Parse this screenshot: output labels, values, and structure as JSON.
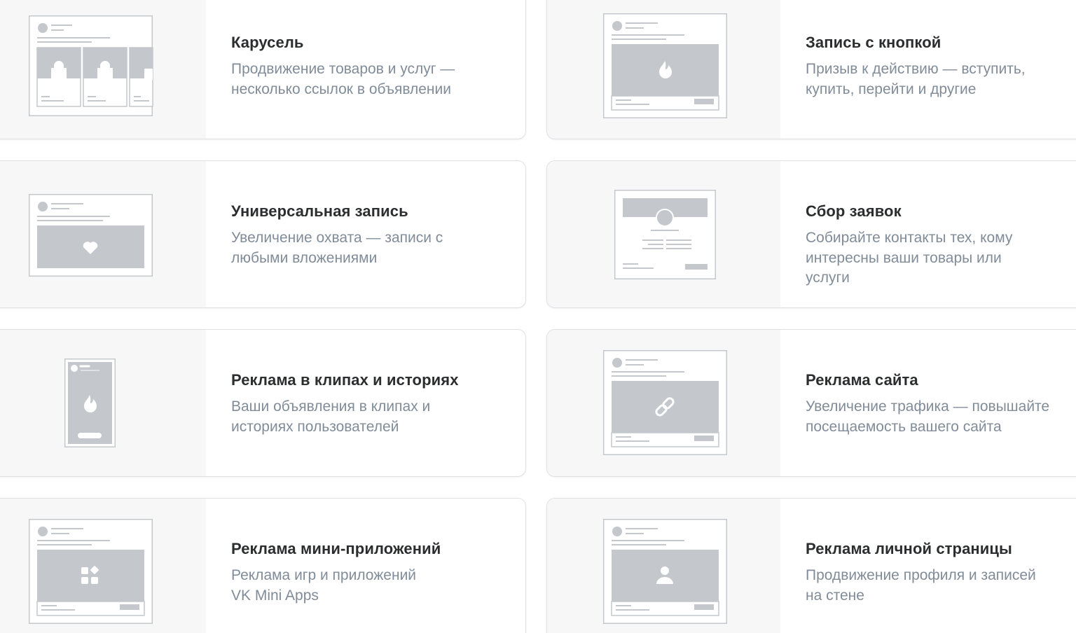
{
  "colors": {
    "card_border": "#dfe1e5",
    "thumb_bg": "#f7f7f8",
    "placeholder": "#c4c8cc",
    "title": "#2c2d2e",
    "description": "#818c99"
  },
  "cards": [
    {
      "id": "carousel",
      "icon": "carousel-preview",
      "title": "Карусель",
      "desc": "Продвижение товаров и услуг —\nнесколько ссылок в объявлении"
    },
    {
      "id": "button_post",
      "icon": "fire-post-preview",
      "title": "Запись с кнопкой",
      "desc": "Призыв к действию — вступить,\nкупить, перейти и другие"
    },
    {
      "id": "universal_post",
      "icon": "heart-post-preview",
      "title": "Универсальная запись",
      "desc": "Увеличение охвата — записи с\nлюбыми вложениями"
    },
    {
      "id": "lead_form",
      "icon": "lead-form-preview",
      "title": "Сбор заявок",
      "desc": "Собирайте контакты тех, кому\nинтересны ваши товары или\nуслуги"
    },
    {
      "id": "clips_stories",
      "icon": "story-fire-preview",
      "title": "Реклама в клипах и историях",
      "desc": "Ваши объявления в клипах и\nисториях пользователей"
    },
    {
      "id": "site_ads",
      "icon": "link-post-preview",
      "title": "Реклама сайта",
      "desc": "Увеличение трафика — повышайте\nпосещаемость вашего сайта"
    },
    {
      "id": "mini_apps",
      "icon": "apps-post-preview",
      "title": "Реклама мини-приложений",
      "desc": "Реклама игр и приложений\nVK Mini Apps"
    },
    {
      "id": "personal_page",
      "icon": "user-post-preview",
      "title": "Реклама личной страницы",
      "desc": "Продвижение профиля и записей\nна стене"
    }
  ]
}
